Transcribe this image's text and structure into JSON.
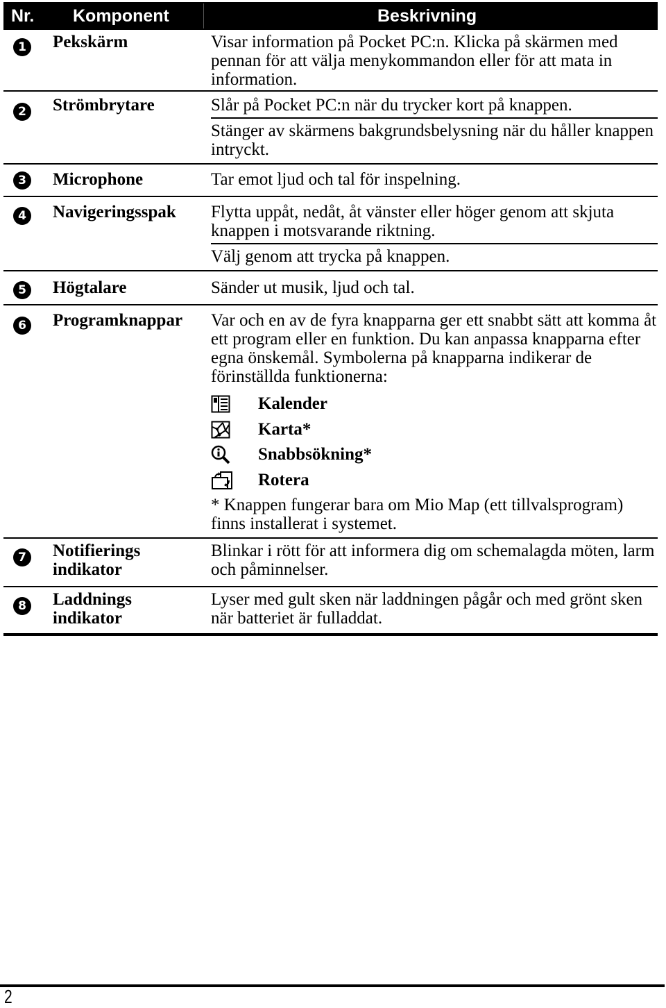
{
  "table": {
    "headers": {
      "nr": "Nr.",
      "component": "Komponent",
      "description": "Beskrivning"
    },
    "rows": [
      {
        "nr": "1",
        "component": "Pekskärm",
        "descriptions": [
          "Visar information på Pocket PC:n. Klicka på skärmen med pennan för att välja menykommandon eller för att mata in information."
        ]
      },
      {
        "nr": "2",
        "component": "Strömbrytare",
        "descriptions": [
          "Slår på Pocket PC:n när du trycker kort på knappen.",
          "Stänger av skärmens bakgrundsbelysning när du håller knappen intryckt."
        ]
      },
      {
        "nr": "3",
        "component": "Microphone",
        "descriptions": [
          "Tar emot ljud och tal för inspelning."
        ]
      },
      {
        "nr": "4",
        "component": "Navigeringsspak",
        "descriptions": [
          "Flytta uppåt, nedåt, åt vänster eller höger genom att skjuta knappen i motsvarande riktning.",
          "Välj genom att trycka på knappen."
        ]
      },
      {
        "nr": "5",
        "component": "Högtalare",
        "descriptions": [
          "Sänder ut musik, ljud och tal."
        ]
      },
      {
        "nr": "6",
        "component": "Programknappar",
        "descriptions": [
          "Var och en av de fyra knapparna ger ett snabbt sätt att komma åt ett program eller en funktion. Du kan anpassa knapparna efter egna önskemål. Symbolerna på knapparna indikerar de förinställda funktionerna:"
        ],
        "buttons": [
          {
            "icon": "calendar-icon",
            "label": "Kalender"
          },
          {
            "icon": "map-icon",
            "label": "Karta*"
          },
          {
            "icon": "info-search-icon",
            "label": "Snabbsökning*"
          },
          {
            "icon": "rotate-icon",
            "label": "Rotera"
          }
        ],
        "note": "* Knappen fungerar bara om Mio Map (ett tillvalsprogram) finns installerat i systemet."
      },
      {
        "nr": "7",
        "component": "Notifierings indikator",
        "descriptions": [
          "Blinkar i rött för att informera dig om schemalagda möten, larm och påminnelser."
        ]
      },
      {
        "nr": "8",
        "component": "Laddnings indikator",
        "descriptions": [
          "Lyser med gult sken när laddningen pågår och med grönt sken när batteriet är fulladdat."
        ]
      }
    ]
  },
  "footer": {
    "page_number": "2"
  }
}
